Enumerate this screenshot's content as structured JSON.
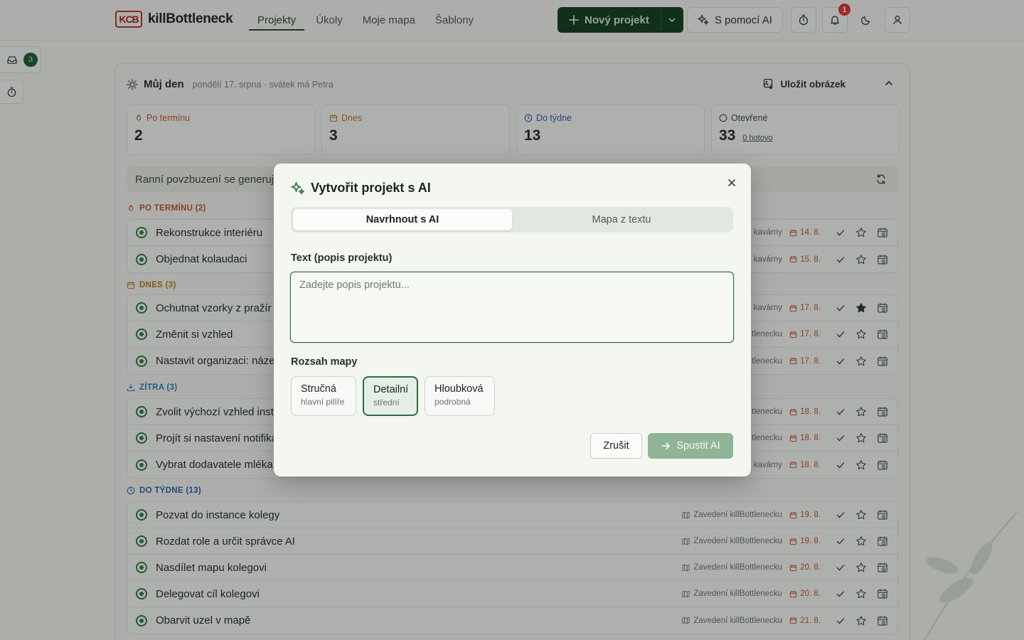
{
  "app": {
    "logo_mark": "KCB",
    "name": "killBottleneck"
  },
  "nav": [
    {
      "label": "Projekty",
      "active": true
    },
    {
      "label": "Úkoly"
    },
    {
      "label": "Moje mapa"
    },
    {
      "label": "Šablony"
    }
  ],
  "toolbar": {
    "new_project": "Nový projekt",
    "ai_button": "S pomocí AI",
    "notifications_count": "1"
  },
  "rail": {
    "inbox_count": "3"
  },
  "day": {
    "title": "Můj den",
    "subtitle": "pondělí 17. srpna · svátek má Petra",
    "save_image": "Uložit obrázek"
  },
  "stats": [
    {
      "label": "Po termínu",
      "value": "2",
      "color": "#c4532e"
    },
    {
      "label": "Dnes",
      "value": "3",
      "color": "#b7791f"
    },
    {
      "label": "Do týdne",
      "value": "13",
      "color": "#2a5db0"
    },
    {
      "label": "Otevřené",
      "value": "33",
      "sub": "0 hotovo",
      "color": "#3c463f"
    }
  ],
  "motivation": "Ranní povzbuzení se generuje",
  "sections": {
    "overdue": {
      "label": "PO TERMÍNU (2)",
      "color": "#c4532e"
    },
    "today": {
      "label": "DNES (3)",
      "color": "#b7791f"
    },
    "tomorrow": {
      "label": "ZÍTRA (3)",
      "color": "#2a7db0"
    },
    "week": {
      "label": "DO TÝDNE (13)",
      "color": "#2a5db0"
    }
  },
  "tasks": {
    "overdue": [
      {
        "title": "Rekonstrukce interiéru",
        "project": "kavárny",
        "date": "14. 8."
      },
      {
        "title": "Objednat kolaudaci",
        "project": "kavárny",
        "date": "15. 8."
      }
    ],
    "today": [
      {
        "title": "Ochutnat vzorky z pražír",
        "project": "kavárny",
        "date": "17. 8."
      },
      {
        "title": "Změnit si vzhled",
        "project": "tlenecku",
        "date": "17. 8."
      },
      {
        "title": "Nastavit organizaci: náze",
        "project": "tlenecku",
        "date": "17. 8."
      }
    ],
    "tomorrow": [
      {
        "title": "Zvolit výchozí vzhled inst",
        "project": "tlenecku",
        "date": "18. 8."
      },
      {
        "title": "Projít si nastavení notifika",
        "project": "tlenecku",
        "date": "18. 8."
      },
      {
        "title": "Vybrat dodavatele mléka",
        "project": "kavárny",
        "date": "18. 8."
      }
    ],
    "week": [
      {
        "title": "Pozvat do instance kolegy",
        "project": "Zavedení killBottlenecku",
        "date": "19. 8."
      },
      {
        "title": "Rozdat role a určit správce AI",
        "project": "Zavedení killBottlenecku",
        "date": "19. 8."
      },
      {
        "title": "Nasdílet mapu kolegovi",
        "project": "Zavedení killBottlenecku",
        "date": "20. 8."
      },
      {
        "title": "Delegovat cíl kolegovi",
        "project": "Zavedení killBottlenecku",
        "date": "20. 8."
      },
      {
        "title": "Obarvit uzel v mapě",
        "project": "Zavedení killBottlenecku",
        "date": "21. 8."
      }
    ]
  },
  "modal": {
    "title": "Vytvořit projekt s AI",
    "tabs": [
      "Navrhnout s AI",
      "Mapa z textu"
    ],
    "text_label": "Text (popis projektu)",
    "text_placeholder": "Zadejte popis projektu...",
    "text_value": "",
    "scope_label": "Rozsah mapy",
    "scope_options": [
      {
        "name": "Stručná",
        "desc": "hlavní pilíře"
      },
      {
        "name": "Detailní",
        "desc": "střední",
        "selected": true
      },
      {
        "name": "Hloubková",
        "desc": "podrobná"
      }
    ],
    "cancel": "Zrušit",
    "run": "Spustit AI"
  },
  "colors": {
    "brand": "#0f3d1f",
    "accent": "#2e6b40",
    "run_disabled": "#8fb596"
  }
}
